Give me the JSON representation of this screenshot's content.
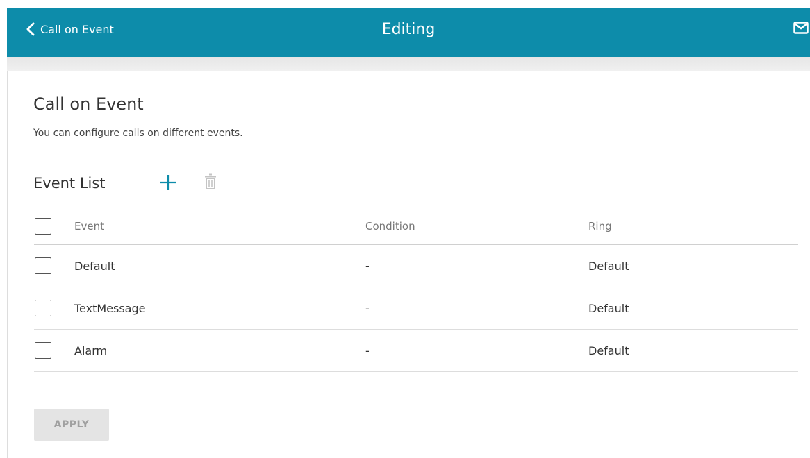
{
  "header": {
    "back_label": "Call on Event",
    "title": "Editing",
    "back_icon": "chevron-left-icon",
    "mail_icon": "envelope-icon",
    "color": "#0d8caa"
  },
  "page": {
    "title": "Call on Event",
    "description": "You can configure calls on different events."
  },
  "event_list": {
    "title": "Event List",
    "add_icon": "plus-icon",
    "delete_icon": "trash-icon",
    "columns": [
      "Event",
      "Condition",
      "Ring"
    ],
    "rows": [
      {
        "event": "Default",
        "condition": "-",
        "ring": "Default"
      },
      {
        "event": "TextMessage",
        "condition": "-",
        "ring": "Default"
      },
      {
        "event": "Alarm",
        "condition": "-",
        "ring": "Default"
      }
    ]
  },
  "apply_label": "APPLY"
}
